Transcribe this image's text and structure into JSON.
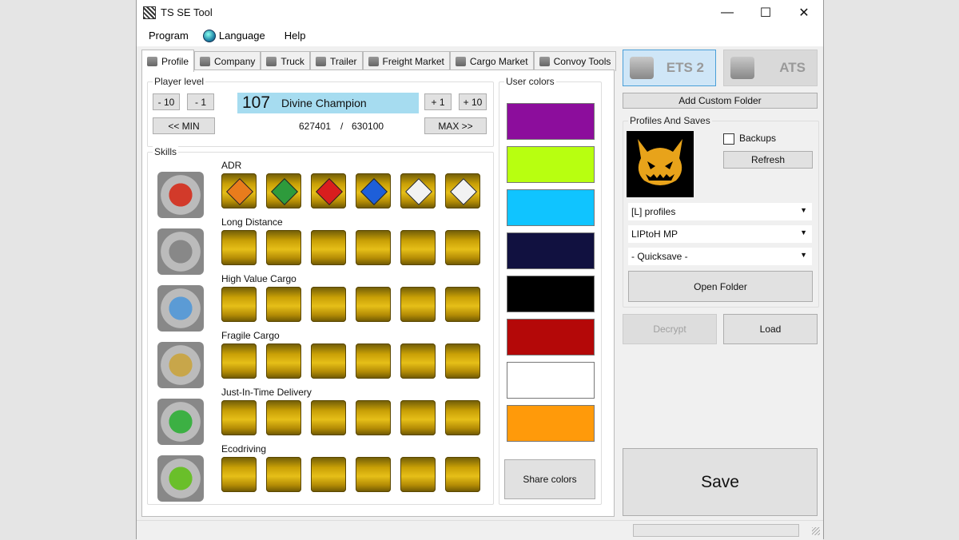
{
  "window": {
    "title": "TS SE Tool",
    "minimize": "—",
    "maximize": "☐",
    "close": "✕"
  },
  "menu": [
    {
      "label": "Program",
      "icon": ""
    },
    {
      "label": "Language",
      "icon": "globe-icon"
    },
    {
      "label": "Help",
      "icon": ""
    }
  ],
  "tabs": [
    {
      "label": "Profile",
      "icon": "profile-icon",
      "active": true
    },
    {
      "label": "Company",
      "icon": "company-icon"
    },
    {
      "label": "Truck",
      "icon": "truck-icon"
    },
    {
      "label": "Trailer",
      "icon": "trailer-icon"
    },
    {
      "label": "Freight Market",
      "icon": "freight-market-icon"
    },
    {
      "label": "Cargo Market",
      "icon": "cargo-market-icon"
    },
    {
      "label": "Convoy Tools",
      "icon": "convoy-tools-icon"
    }
  ],
  "player_level": {
    "group_label": "Player level",
    "minus10": "- 10",
    "minus1": "- 1",
    "plus1": "+ 1",
    "plus10": "+ 10",
    "min": "<< MIN",
    "max": "MAX >>",
    "level": "107",
    "rank": "Divine Champion",
    "xp_current": "627401",
    "xp_sep": "/",
    "xp_next": "630100"
  },
  "skills": {
    "group_label": "Skills",
    "rows": [
      {
        "name": "ADR",
        "icon": "adr-skill-icon",
        "color": "#d23a2a"
      },
      {
        "name": "Long Distance",
        "icon": "long-distance-skill-icon",
        "color": "#888888"
      },
      {
        "name": "High Value Cargo",
        "icon": "high-value-cargo-skill-icon",
        "color": "#5b9bd5"
      },
      {
        "name": "Fragile Cargo",
        "icon": "fragile-cargo-skill-icon",
        "color": "#c8a64a"
      },
      {
        "name": "Just-In-Time Delivery",
        "icon": "just-in-time-skill-icon",
        "color": "#3cb043"
      },
      {
        "name": "Ecodriving",
        "icon": "ecodriving-skill-icon",
        "color": "#6abf2a"
      }
    ],
    "adr_badge_colors": [
      "#e97c1c",
      "#2e9b3c",
      "#d91e1e",
      "#1e5fd9",
      "#f2f2f2",
      "#f2f2f2"
    ],
    "adr_badge_icons": [
      "explosives-icon",
      "non-flammable-gas-icon",
      "flammable-icon",
      "dangerous-when-wet-icon",
      "toxic-icon",
      "corrosive-icon"
    ]
  },
  "user_colors": {
    "group_label": "User colors",
    "swatches": [
      "#8c0d9c",
      "#b8ff10",
      "#10c4ff",
      "#111140",
      "#000000",
      "#b40808",
      "#ffffff",
      "#ff9a0a"
    ],
    "share": "Share colors"
  },
  "game": {
    "ets2": "ETS 2",
    "ats": "ATS"
  },
  "add_custom_folder": "Add Custom Folder",
  "profiles": {
    "group_label": "Profiles And Saves",
    "backups": "Backups",
    "refresh": "Refresh",
    "avatar": "pumpkin-face-avatar-icon",
    "combo1": "[L] profiles",
    "combo2": "LIPtoH MP",
    "combo3": "- Quicksave -",
    "open_folder": "Open Folder"
  },
  "decrypt": "Decrypt",
  "load": "Load",
  "save": "Save"
}
